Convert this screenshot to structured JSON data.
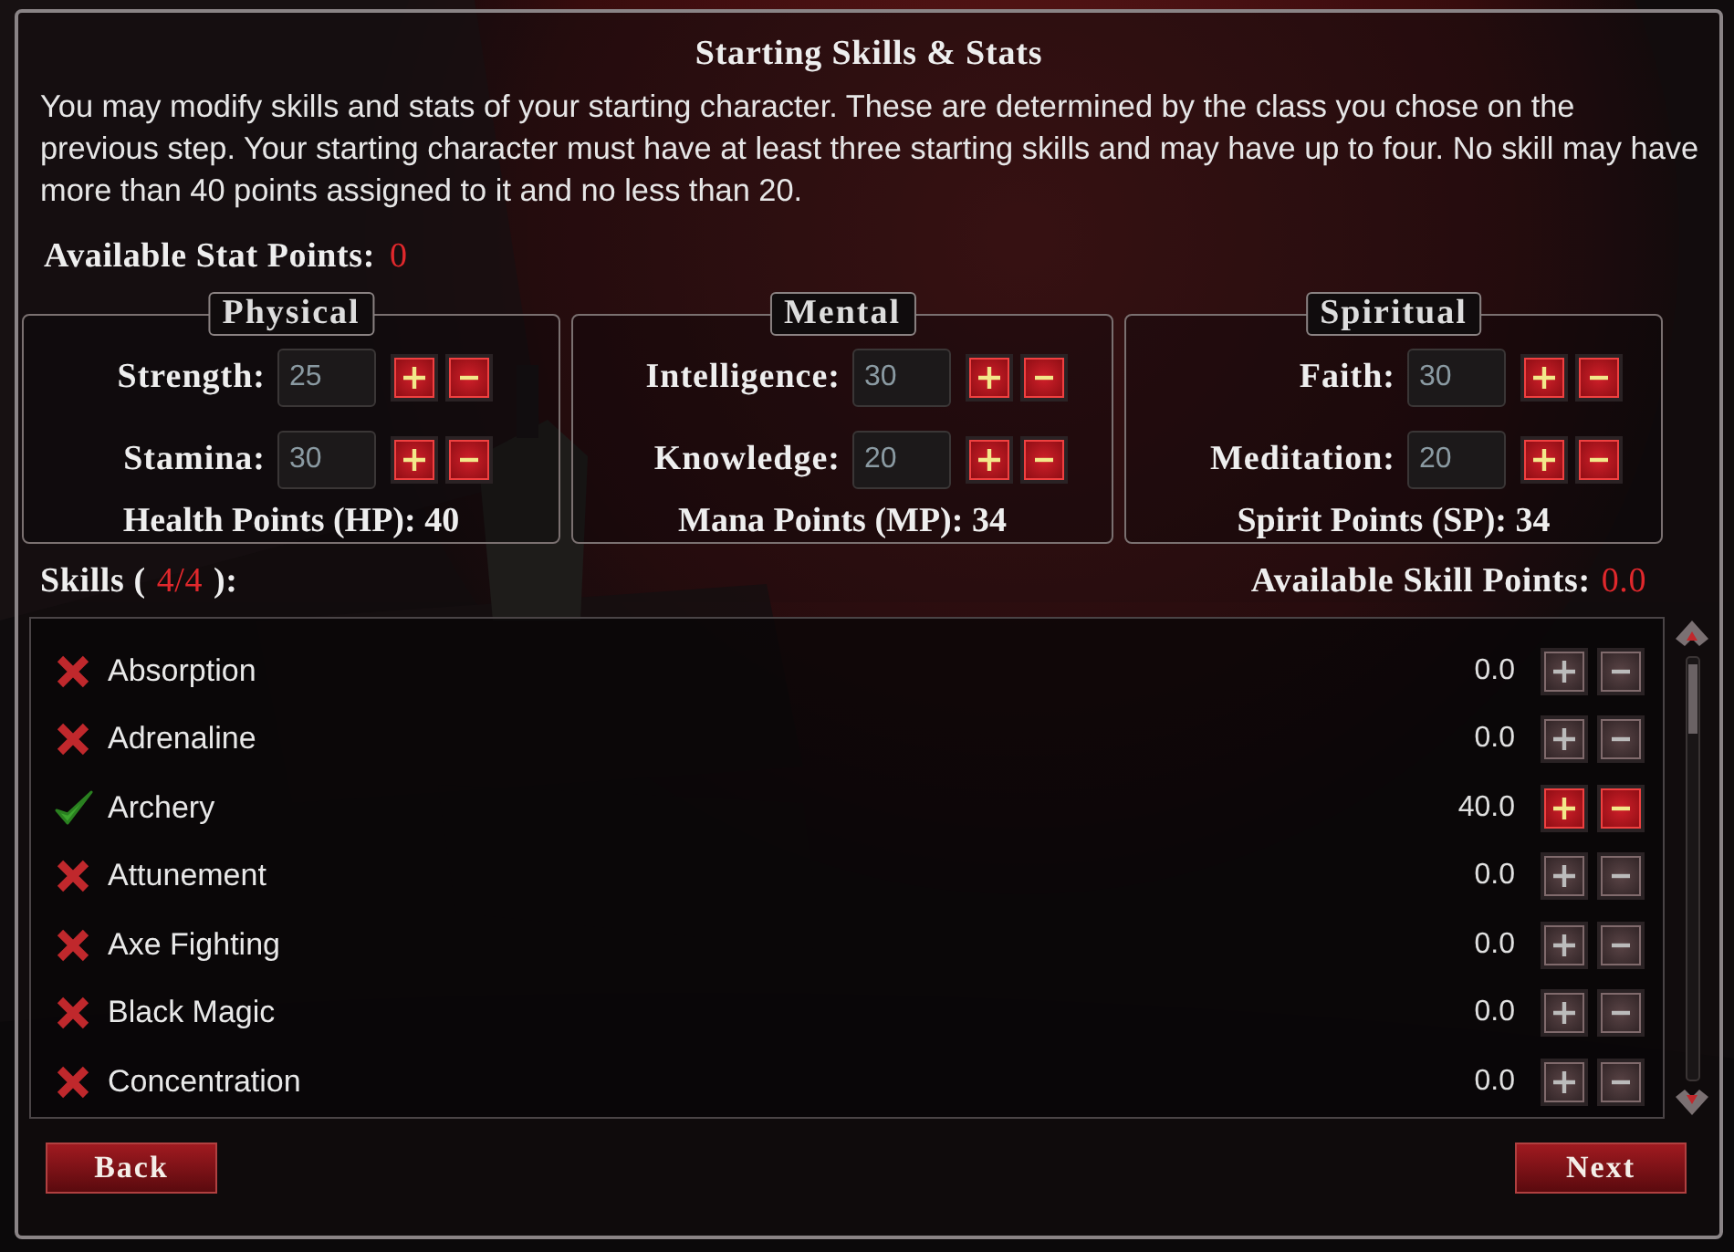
{
  "title": "Starting Skills & Stats",
  "description": "You may modify skills and stats of your starting character. These are determined by the class you chose on the previous step. Your starting character must have at least three starting skills and may have up to four. No skill may have more than 40 points assigned to it and no less than 20.",
  "available_stat_points": {
    "label": "Available Stat Points:",
    "value": "0"
  },
  "stat_groups": [
    {
      "title": "Physical",
      "stats": [
        {
          "label": "Strength:",
          "value": "25"
        },
        {
          "label": "Stamina:",
          "value": "30"
        }
      ],
      "total": "Health Points (HP): 40"
    },
    {
      "title": "Mental",
      "stats": [
        {
          "label": "Intelligence:",
          "value": "30"
        },
        {
          "label": "Knowledge:",
          "value": "20"
        }
      ],
      "total": "Mana Points (MP): 34"
    },
    {
      "title": "Spiritual",
      "stats": [
        {
          "label": "Faith:",
          "value": "30"
        },
        {
          "label": "Meditation:",
          "value": "20"
        }
      ],
      "total": "Spirit Points (SP): 34"
    }
  ],
  "skills_header": {
    "label": "Skills (",
    "count": "4/4",
    "close": "):"
  },
  "available_skill_points": {
    "label": "Available Skill Points:",
    "value": "0.0"
  },
  "skills": [
    {
      "name": "Absorption",
      "value": "0.0",
      "selected": false
    },
    {
      "name": "Adrenaline",
      "value": "0.0",
      "selected": false
    },
    {
      "name": "Archery",
      "value": "40.0",
      "selected": true
    },
    {
      "name": "Attunement",
      "value": "0.0",
      "selected": false
    },
    {
      "name": "Axe Fighting",
      "value": "0.0",
      "selected": false
    },
    {
      "name": "Black Magic",
      "value": "0.0",
      "selected": false
    },
    {
      "name": "Concentration",
      "value": "0.0",
      "selected": false
    }
  ],
  "buttons": {
    "back": "Back",
    "next": "Next"
  }
}
